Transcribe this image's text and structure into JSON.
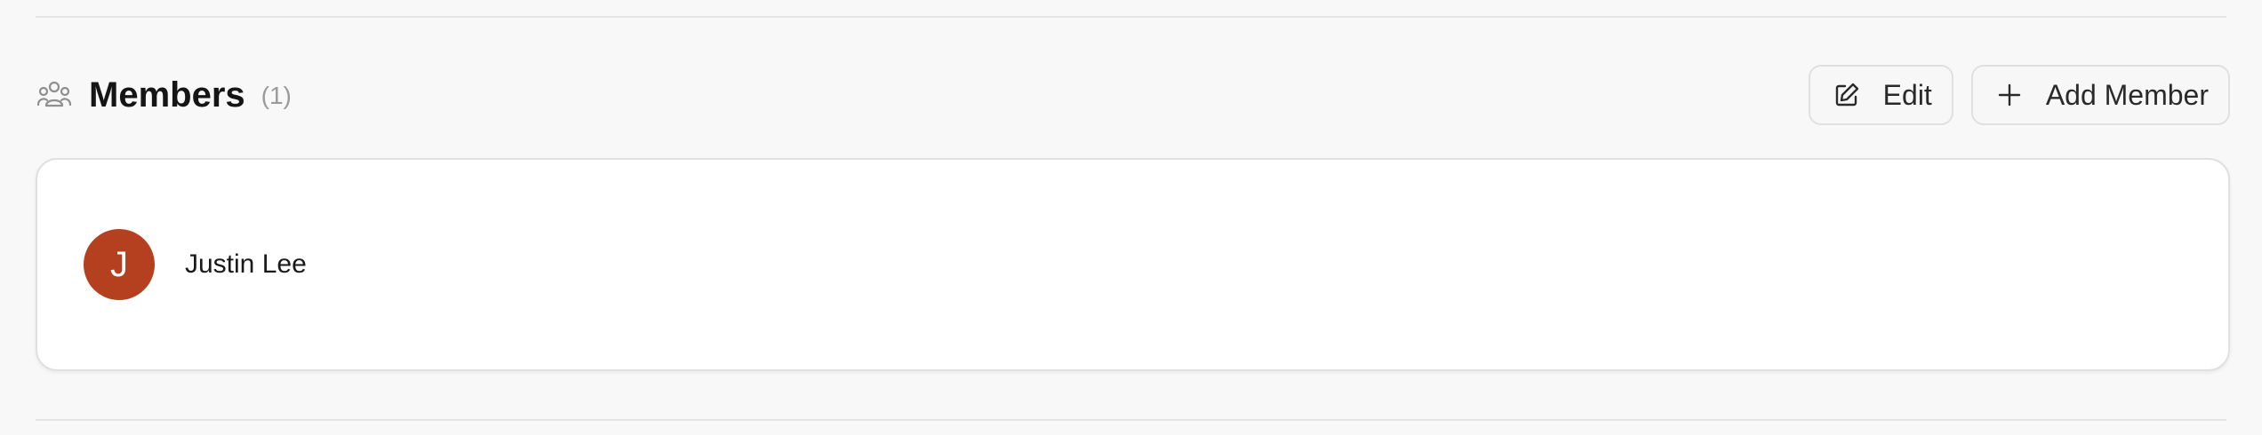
{
  "section": {
    "title": "Members",
    "count": "(1)",
    "icon": "members-icon"
  },
  "actions": {
    "edit_label": "Edit",
    "edit_icon": "pencil-icon",
    "add_label": "Add Member",
    "add_icon": "plus-icon"
  },
  "members": [
    {
      "initial": "J",
      "name": "Justin Lee",
      "avatar_color": "#b5401f"
    }
  ]
}
